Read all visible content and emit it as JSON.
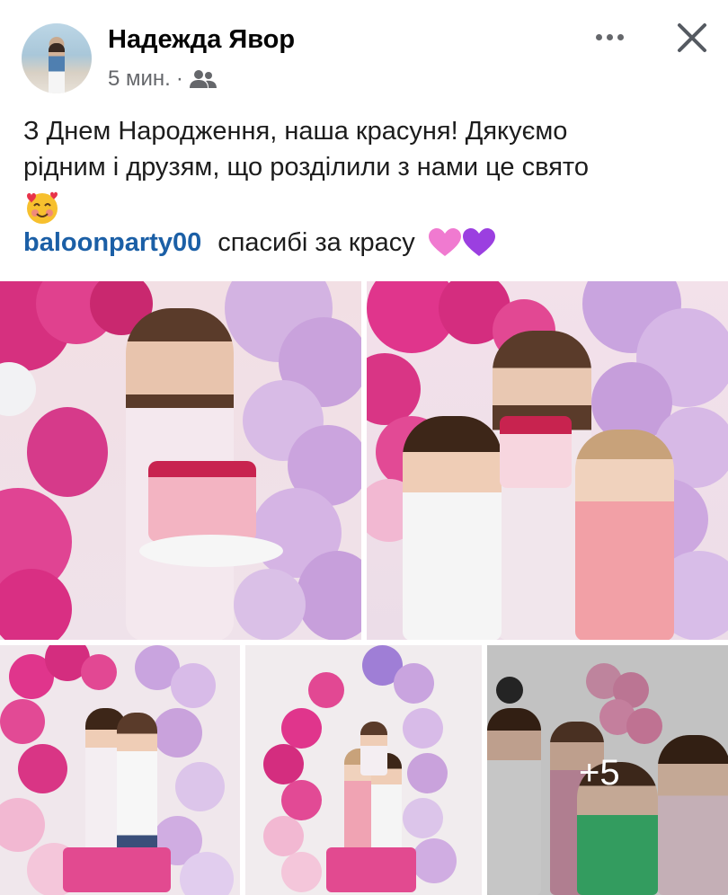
{
  "post": {
    "author": "Надежда Явор",
    "time": "5 мин.",
    "separator": "·",
    "audience_icon": "friends-icon",
    "text_line1": "З Днем Народження,  наша красуня! Дякуємо",
    "text_line2": "рідним і друзям, що розділили з нами це свято",
    "tag_name": "baloonparty00",
    "tag_text": "спасибі за красу",
    "more_photos": "+5"
  },
  "colors": {
    "link": "#1b5fa6",
    "secondary_text": "#65676b",
    "balloon_pink": "#e0358c",
    "balloon_lilac": "#c9a6e0"
  }
}
